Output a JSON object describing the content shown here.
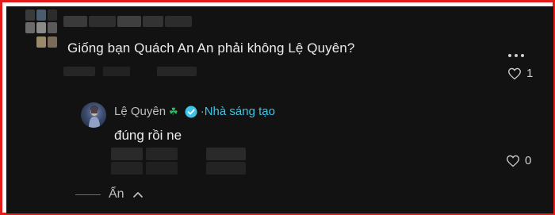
{
  "comment": {
    "text": "Giống bạn Quách An An phải không Lệ Quyên?",
    "like_count": "1"
  },
  "reply": {
    "author": "Lệ Quyên",
    "author_badge_icon": "four-leaf-clover-icon",
    "verified_icon": "verified-check-icon",
    "creator_label": "·Nhà sáng tạo",
    "text": "đúng rồi ne",
    "like_count": "0"
  },
  "thread": {
    "hide_label": "Ẩn"
  },
  "colors": {
    "border": "#e21b1b",
    "background": "#121212",
    "creator": "#3ec4e6",
    "clover": "#39b56a"
  }
}
